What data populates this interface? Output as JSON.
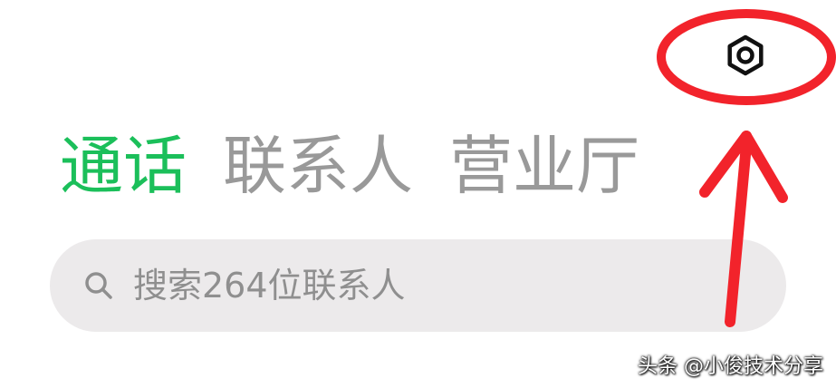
{
  "tabs": [
    {
      "label": "通话",
      "active": true
    },
    {
      "label": "联系人",
      "active": false
    },
    {
      "label": "营业厅",
      "active": false
    }
  ],
  "search": {
    "placeholder": "搜索264位联系人",
    "icon": "search-icon"
  },
  "toolbar": {
    "settings_icon": "gear-icon"
  },
  "watermark": {
    "text": "头条 @小俊技术分享"
  },
  "colors": {
    "active_tab": "#1bbf5a",
    "inactive_tab": "#999999",
    "search_background": "#eceaeb",
    "annotation": "#f2232b"
  }
}
